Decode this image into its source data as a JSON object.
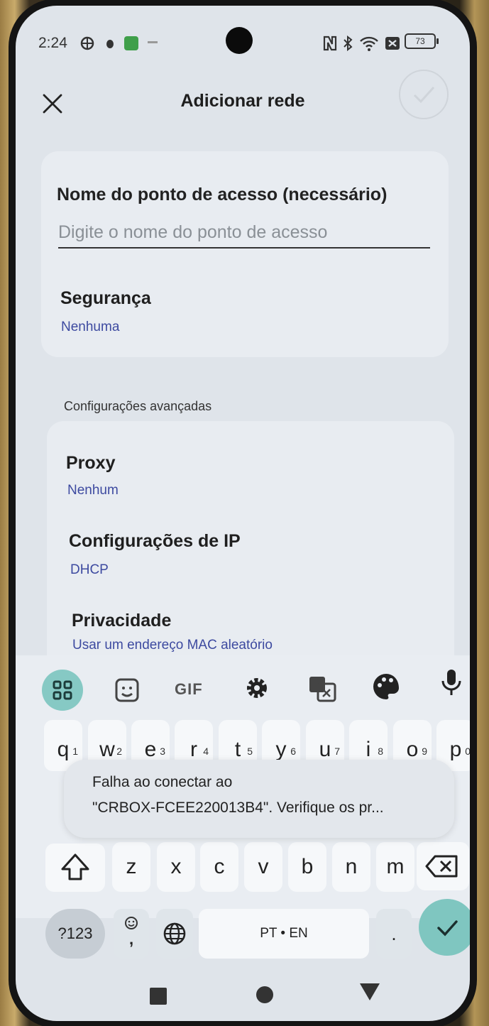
{
  "status": {
    "time": "2:24",
    "battery": "73"
  },
  "header": {
    "title": "Adicionar rede"
  },
  "form": {
    "ssid_label": "Nome do ponto de acesso (necessário)",
    "ssid_placeholder": "Digite o nome do ponto de acesso",
    "ssid_value": "",
    "security_label": "Segurança",
    "security_value": "Nenhuma"
  },
  "advanced": {
    "section_label": "Configurações avançadas",
    "proxy_label": "Proxy",
    "proxy_value": "Nenhum",
    "ip_label": "Configurações de IP",
    "ip_value": "DHCP",
    "privacy_label": "Privacidade",
    "privacy_value": "Usar um endereço MAC aleatório"
  },
  "keyboard": {
    "toolbar": {
      "gif": "GIF"
    },
    "row1": [
      {
        "k": "q",
        "h": "1"
      },
      {
        "k": "w",
        "h": "2"
      },
      {
        "k": "e",
        "h": "3"
      },
      {
        "k": "r",
        "h": "4"
      },
      {
        "k": "t",
        "h": "5"
      },
      {
        "k": "y",
        "h": "6"
      },
      {
        "k": "u",
        "h": "7"
      },
      {
        "k": "i",
        "h": "8"
      },
      {
        "k": "o",
        "h": "9"
      },
      {
        "k": "p",
        "h": "0"
      }
    ],
    "row3": [
      "z",
      "x",
      "c",
      "v",
      "b",
      "n",
      "m"
    ],
    "symbols_key": "?123",
    "emoji_comma": ",",
    "space_label": "PT • EN",
    "period": "."
  },
  "toast": {
    "line1": "Falha ao conectar ao",
    "line2": "\"CRBOX-FCEE220013B4\". Verifique os pr..."
  },
  "colors": {
    "accent": "#7fc6c0",
    "link": "#3d4aa0"
  }
}
